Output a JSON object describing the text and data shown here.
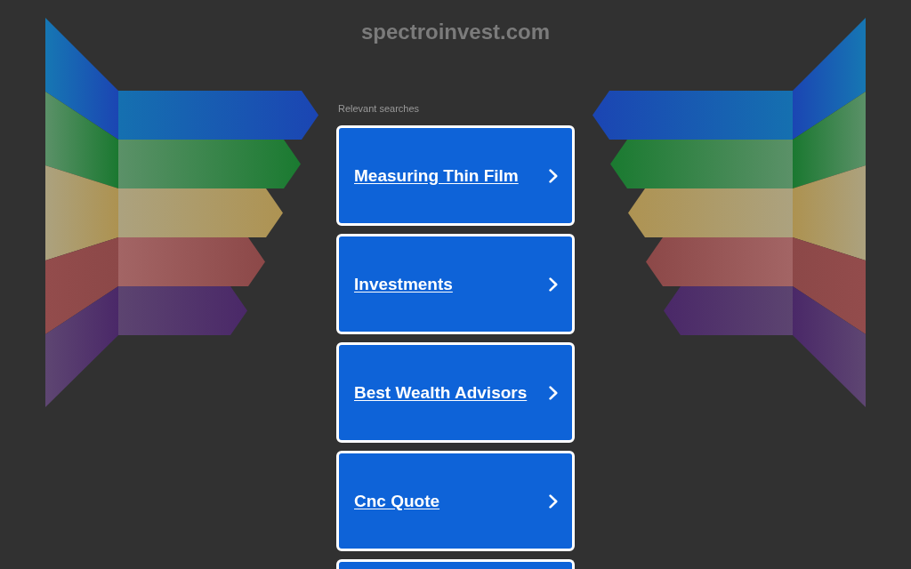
{
  "header": {
    "domain": "spectroinvest.com"
  },
  "searches": {
    "heading": "Relevant searches",
    "links": [
      {
        "kind": "full",
        "label": "Measuring Thin Film"
      },
      {
        "kind": "full",
        "label": "Investments"
      },
      {
        "kind": "full",
        "label": "Best Wealth Advisors"
      },
      {
        "kind": "full",
        "label": "Cnc Quote"
      },
      {
        "kind": "cut"
      }
    ]
  }
}
